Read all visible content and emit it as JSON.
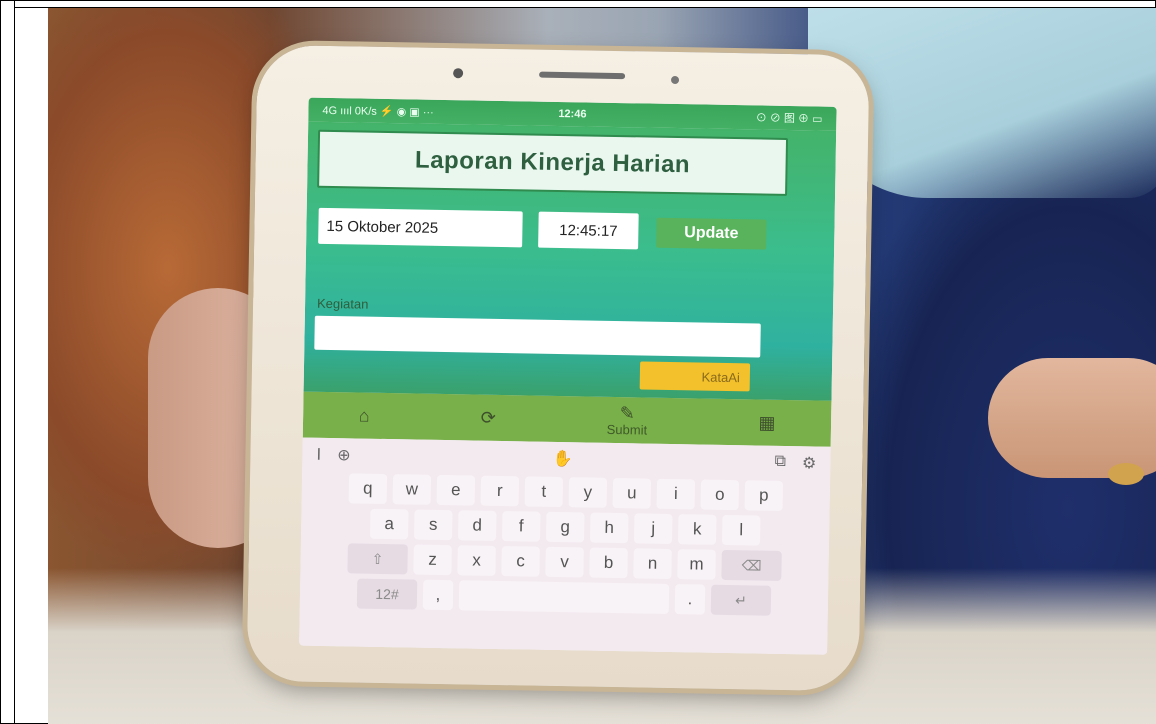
{
  "status_bar": {
    "left": "4G ıııl 0K/s ⚡ ◉ ▣ ···",
    "time": "12:46",
    "right": "⊙ ⊘ 图 ⊕ ▭"
  },
  "app": {
    "title": "Laporan Kinerja Harian",
    "date_value": "15 Oktober 2025",
    "time_value": "12:45:17",
    "update_label": "Update",
    "notice_text": "",
    "kegiatan_label": "Kegiatan",
    "kegiatan_placeholder": "",
    "kata_button_label": "KataAi"
  },
  "bottom_nav": {
    "items": [
      {
        "icon": "home-icon",
        "glyph": "⌂",
        "label": ""
      },
      {
        "icon": "refresh-icon",
        "glyph": "⟳",
        "label": ""
      },
      {
        "icon": "pencil-icon",
        "glyph": "✎",
        "label": "Submit"
      },
      {
        "icon": "clipboard-icon",
        "glyph": "▦",
        "label": ""
      }
    ]
  },
  "keyboard": {
    "toolbar": {
      "cursor_icon": "Ⅰ",
      "globe_icon": "⊕",
      "hand_icon": "✋",
      "clipboard_icon": "⧉",
      "settings_icon": "⚙"
    },
    "row1": [
      "q",
      "w",
      "e",
      "r",
      "t",
      "y",
      "u",
      "i",
      "o",
      "p"
    ],
    "row2": [
      "a",
      "s",
      "d",
      "f",
      "g",
      "h",
      "j",
      "k",
      "l"
    ],
    "row3": [
      "z",
      "x",
      "c",
      "v",
      "b",
      "n",
      "m"
    ],
    "shift_glyph": "⇧",
    "backspace_glyph": "⌫",
    "symbols_label": "12#",
    "comma_label": ",",
    "space_label": "",
    "period_label": ".",
    "enter_glyph": "↵"
  },
  "system_nav": {
    "menu": "≡",
    "home": "⌂",
    "back": "↩"
  },
  "colors": {
    "app_green": "#44b36a",
    "update_green": "#58b35c",
    "kata_yellow": "#f2c12b",
    "nav_green": "#79b049"
  }
}
